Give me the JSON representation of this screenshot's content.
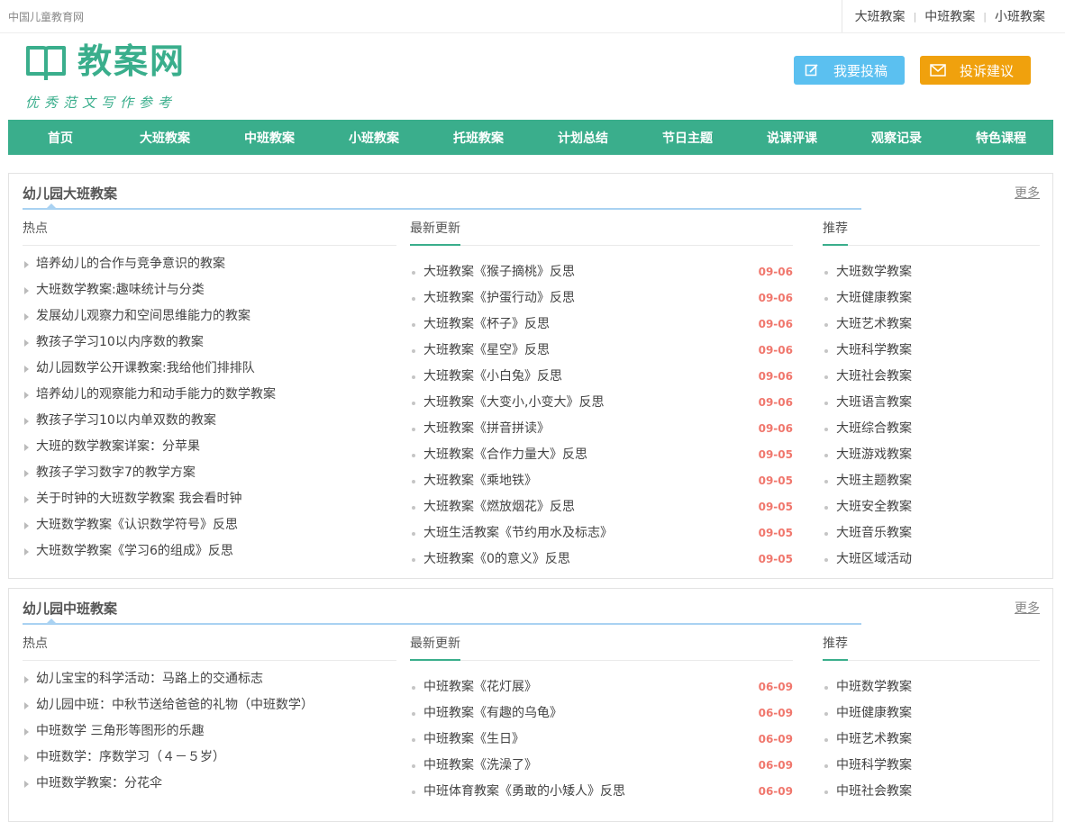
{
  "topbar": {
    "site_name": "中国儿童教育网",
    "links": [
      "大班教案",
      "中班教案",
      "小班教案"
    ]
  },
  "header": {
    "logo_text": "教案网",
    "slogan": "优秀范文写作参考",
    "post_button": "我要投稿",
    "complain_button": "投诉建议"
  },
  "nav": [
    "首页",
    "大班教案",
    "中班教案",
    "小班教案",
    "托班教案",
    "计划总结",
    "节日主题",
    "说课评课",
    "观察记录",
    "特色课程"
  ],
  "sections": [
    {
      "title": "幼儿园大班教案",
      "more": "更多",
      "hot_title": "热点",
      "new_title": "最新更新",
      "rec_title": "推荐",
      "hot": [
        "培养幼儿的合作与竞争意识的教案",
        "大班数学教案:趣味统计与分类",
        "发展幼儿观察力和空间思维能力的教案",
        "教孩子学习10以内序数的教案",
        "幼儿园数学公开课教案:我给他们排排队",
        "培养幼儿的观察能力和动手能力的数学教案",
        "教孩子学习10以内单双数的教案",
        "大班的数学教案详案：分苹果",
        "教孩子学习数字7的教学方案",
        "关于时钟的大班数学教案 我会看时钟",
        "大班数学教案《认识数学符号》反思",
        "大班数学教案《学习6的组成》反思"
      ],
      "new": [
        {
          "title": "大班教案《猴子摘桃》反思",
          "date": "09-06"
        },
        {
          "title": "大班教案《护蛋行动》反思",
          "date": "09-06"
        },
        {
          "title": "大班教案《杯子》反思",
          "date": "09-06"
        },
        {
          "title": "大班教案《星空》反思",
          "date": "09-06"
        },
        {
          "title": "大班教案《小白兔》反思",
          "date": "09-06"
        },
        {
          "title": "大班教案《大变小,小变大》反思",
          "date": "09-06"
        },
        {
          "title": "大班教案《拼音拼读》",
          "date": "09-06"
        },
        {
          "title": "大班教案《合作力量大》反思",
          "date": "09-05"
        },
        {
          "title": "大班教案《乘地铁》",
          "date": "09-05"
        },
        {
          "title": "大班教案《燃放烟花》反思",
          "date": "09-05"
        },
        {
          "title": "大班生活教案《节约用水及标志》",
          "date": "09-05"
        },
        {
          "title": "大班教案《0的意义》反思",
          "date": "09-05"
        }
      ],
      "rec": [
        "大班数学教案",
        "大班健康教案",
        "大班艺术教案",
        "大班科学教案",
        "大班社会教案",
        "大班语言教案",
        "大班综合教案",
        "大班游戏教案",
        "大班主题教案",
        "大班安全教案",
        "大班音乐教案",
        "大班区域活动"
      ]
    },
    {
      "title": "幼儿园中班教案",
      "more": "更多",
      "hot_title": "热点",
      "new_title": "最新更新",
      "rec_title": "推荐",
      "hot": [
        "幼儿宝宝的科学活动：马路上的交通标志",
        "幼儿园中班：中秋节送给爸爸的礼物（中班数学）",
        "中班数学 三角形等图形的乐趣",
        "中班数学：序数学习（４－５岁）",
        "中班数学教案：分花伞"
      ],
      "new": [
        {
          "title": "中班教案《花灯展》",
          "date": "06-09"
        },
        {
          "title": "中班教案《有趣的乌龟》",
          "date": "06-09"
        },
        {
          "title": "中班教案《生日》",
          "date": "06-09"
        },
        {
          "title": "中班教案《洗澡了》",
          "date": "06-09"
        },
        {
          "title": "中班体育教案《勇敢的小矮人》反思",
          "date": "06-09"
        }
      ],
      "rec": [
        "中班数学教案",
        "中班健康教案",
        "中班艺术教案",
        "中班科学教案",
        "中班社会教案"
      ]
    }
  ],
  "colors": {
    "brand": "#3aae8c",
    "post": "#5bc0f0",
    "complain": "#f0a10d",
    "date": "#f0776d"
  },
  "icons": {
    "logo": "open-book-icon",
    "post": "edit-icon",
    "complain": "mail-icon"
  }
}
